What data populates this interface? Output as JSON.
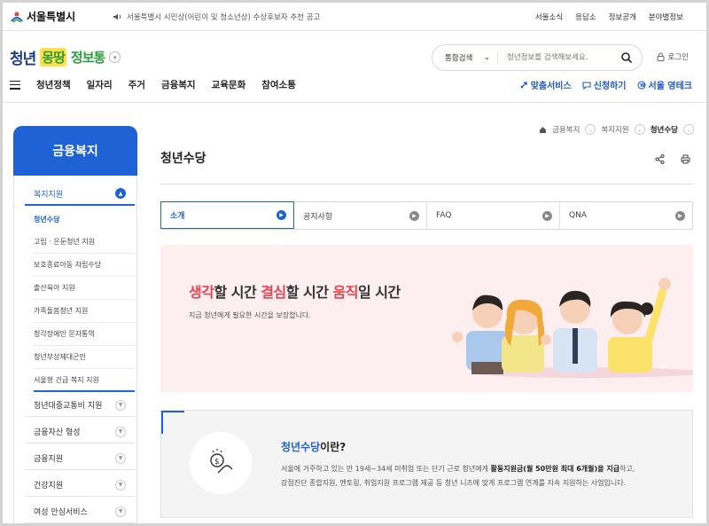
{
  "topbar": {
    "seoul_logo": "서울특별시",
    "notice": "서울특별시 시민상(어린이 및 청소년상) 수상후보자 추천 공고",
    "links": [
      "서울소식",
      "응답소",
      "정보공개",
      "분야별정보"
    ]
  },
  "header": {
    "logo": {
      "part1": "청년",
      "part2": "몽땅",
      "part3": "정보통"
    },
    "search": {
      "scope": "통합검색",
      "placeholder": "청년정보를 검색해보세요."
    },
    "login": "로그인",
    "gnb": [
      "청년정책",
      "일자리",
      "주거",
      "금융복지",
      "교육문화",
      "참여소통"
    ],
    "quick": [
      "맞춤서비스",
      "신청하기",
      "서울 영테크"
    ]
  },
  "lnb": {
    "title": "금융복지",
    "active_group": "복지지원",
    "sub_items": [
      "청년수당",
      "고립 · 은둔청년 지원",
      "보호종료아동 자립수당",
      "출산육아 지원",
      "가족돌봄청년 지원",
      "청각장애인 문자통역",
      "청년부상제대군인",
      "서울형 긴급 복지 지원"
    ],
    "groups": [
      "청년대중교통비 지원",
      "금융자산 형성",
      "금융지원",
      "건강지원",
      "여성 안심서비스"
    ]
  },
  "content": {
    "breadcrumb": [
      "금융복지",
      "복지지원",
      "청년수당"
    ],
    "title": "청년수당",
    "tabs": [
      "소개",
      "공지사항",
      "FAQ",
      "QNA"
    ],
    "banner": {
      "w1": "생각",
      "t1": "할 시간 ",
      "w2": "결심",
      "t2": "할 시간 ",
      "w3": "움직",
      "t3": "일 시간",
      "sub": "지금 청년에게 필요한 시간을 보장합니다."
    },
    "info": {
      "title_hl": "청년수당",
      "title_rest": "이란?",
      "line1_a": "서울에 거주하고 있는 만 19세~34세 미취업 또는 단기 근로 청년에게 ",
      "line1_b": "활동지원금(월 50만원 최대 6개월)을 지급",
      "line1_c": "하고,",
      "line2": "강점진단 종합지원, 멘토링, 취업지원 프로그램 제공 등 청년 니즈에 맞게 프로그램 연계를 지속 지원하는 사업입니다."
    }
  },
  "colors": {
    "primary": "#1e62d6",
    "accent_red": "#e8434f",
    "banner_bg": "#fdeef0"
  }
}
